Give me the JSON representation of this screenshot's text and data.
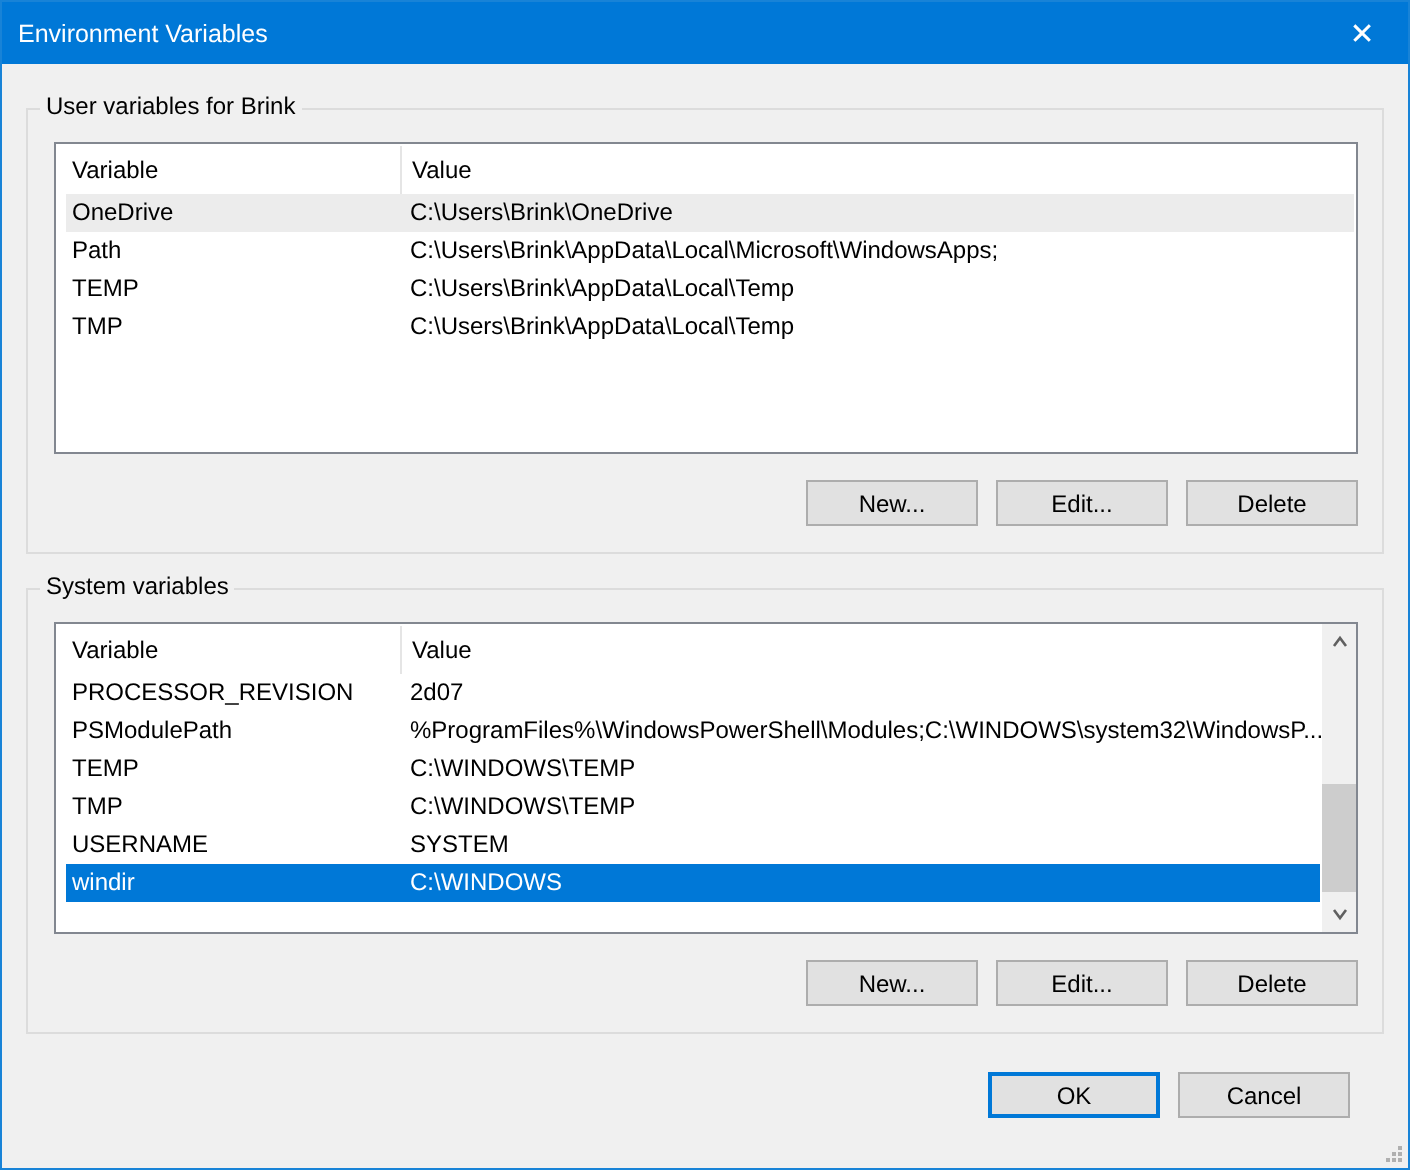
{
  "window": {
    "title": "Environment Variables",
    "close": "✕"
  },
  "groups": [
    {
      "title": "User variables for Brink",
      "focused": false,
      "scrollbar": false,
      "columns": [
        "Variable",
        "Value"
      ],
      "rows": [
        {
          "variable": "OneDrive",
          "value": "C:\\Users\\Brink\\OneDrive",
          "selected": true
        },
        {
          "variable": "Path",
          "value": "C:\\Users\\Brink\\AppData\\Local\\Microsoft\\WindowsApps;",
          "selected": false
        },
        {
          "variable": "TEMP",
          "value": "C:\\Users\\Brink\\AppData\\Local\\Temp",
          "selected": false
        },
        {
          "variable": "TMP",
          "value": "C:\\Users\\Brink\\AppData\\Local\\Temp",
          "selected": false
        }
      ],
      "buttons": [
        "New...",
        "Edit...",
        "Delete"
      ]
    },
    {
      "title": "System variables",
      "focused": true,
      "scrollbar": true,
      "columns": [
        "Variable",
        "Value"
      ],
      "rows": [
        {
          "variable": "PROCESSOR_REVISION",
          "value": "2d07",
          "selected": false
        },
        {
          "variable": "PSModulePath",
          "value": "%ProgramFiles%\\WindowsPowerShell\\Modules;C:\\WINDOWS\\system32\\WindowsP...",
          "selected": false
        },
        {
          "variable": "TEMP",
          "value": "C:\\WINDOWS\\TEMP",
          "selected": false
        },
        {
          "variable": "TMP",
          "value": "C:\\WINDOWS\\TEMP",
          "selected": false
        },
        {
          "variable": "USERNAME",
          "value": "SYSTEM",
          "selected": false
        },
        {
          "variable": "windir",
          "value": "C:\\WINDOWS",
          "selected": true
        }
      ],
      "buttons": [
        "New...",
        "Edit...",
        "Delete"
      ]
    }
  ],
  "footer_buttons": [
    {
      "label": "OK",
      "default": true
    },
    {
      "label": "Cancel",
      "default": false
    }
  ]
}
